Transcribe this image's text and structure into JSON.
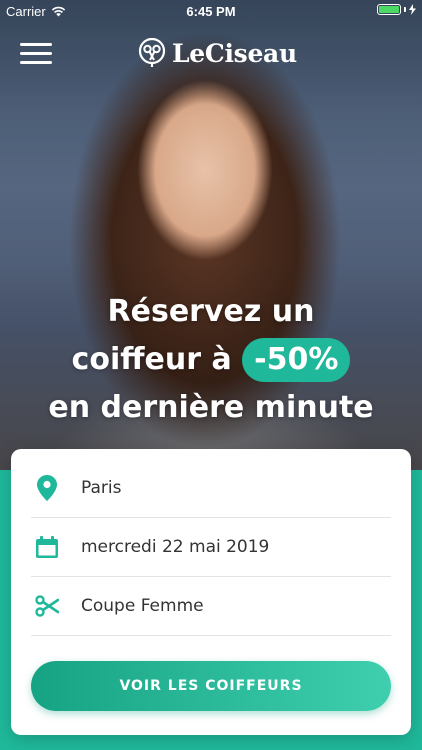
{
  "status_bar": {
    "carrier": "Carrier",
    "time": "6:45 PM",
    "battery_level": 1.0
  },
  "header": {
    "brand": "LeCiseau"
  },
  "hero": {
    "line1": "Réservez un",
    "line2_prefix": "coiffeur à",
    "line2_highlight": "-50%",
    "line3": "en dernière minute"
  },
  "search": {
    "location": "Paris",
    "date": "mercredi 22 mai 2019",
    "service": "Coupe Femme",
    "cta_label": "VOIR LES COIFFEURS"
  },
  "colors": {
    "accent": "#1fb89a",
    "accent_dark": "#16a383"
  },
  "icons": {
    "location": "map-pin-icon",
    "date": "calendar-icon",
    "service": "scissors-icon",
    "menu": "hamburger-icon",
    "logo": "scissors-circle-logo-icon"
  }
}
